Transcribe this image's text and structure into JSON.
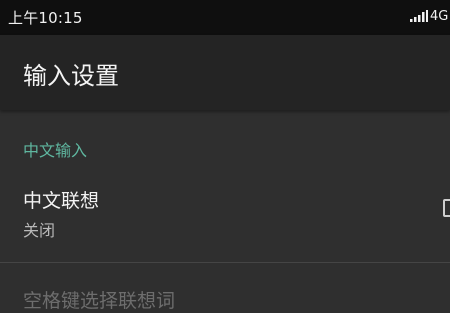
{
  "status_bar": {
    "time": "上午10:15",
    "network": "4G",
    "icons": [
      "signal-icon"
    ]
  },
  "app_bar": {
    "title": "输入设置"
  },
  "section": {
    "header": "中文输入"
  },
  "preferences": [
    {
      "title": "中文联想",
      "summary": "关闭",
      "checked": false,
      "enabled": true
    },
    {
      "title": "空格键选择联想词",
      "enabled": false
    }
  ],
  "colors": {
    "background": "#2f2f2f",
    "status_bar": "#0f0f0f",
    "app_bar": "#242424",
    "accent": "#5fb7a0",
    "divider": "#454545"
  }
}
